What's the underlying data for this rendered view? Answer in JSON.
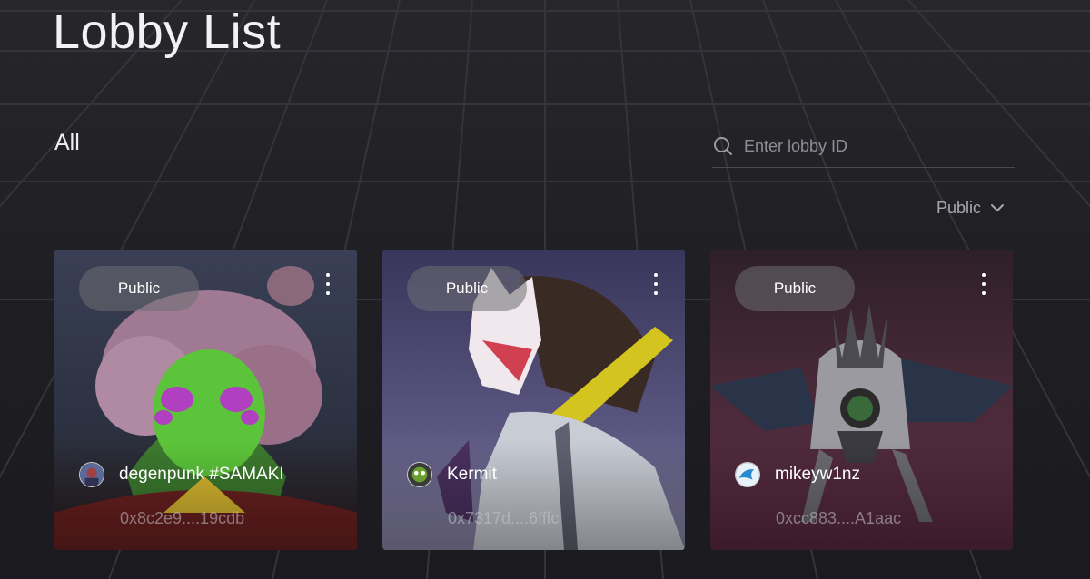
{
  "page": {
    "title": "Lobby List"
  },
  "filter": {
    "label": "All"
  },
  "search": {
    "placeholder": "Enter lobby ID",
    "value": "",
    "icon": "search-icon"
  },
  "visibility_dropdown": {
    "selected": "Public",
    "icon": "chevron-down-icon"
  },
  "lobbies": [
    {
      "badge": "Public",
      "owner_name": "degenpunk #SAMAKI",
      "owner_address": "0x8c2e9....19cdb",
      "art": "pixel-art-character"
    },
    {
      "badge": "Public",
      "owner_name": "Kermit",
      "owner_address": "0x7317d....6fffc",
      "art": "masked-swordsman"
    },
    {
      "badge": "Public",
      "owner_name": "mikeyw1nz",
      "owner_address": "0xcc883....A1aac",
      "art": "bat-winged-creature"
    }
  ],
  "colors": {
    "background": "#1d1d21",
    "text": "#f2f2f4",
    "muted": "#8e8e96"
  }
}
